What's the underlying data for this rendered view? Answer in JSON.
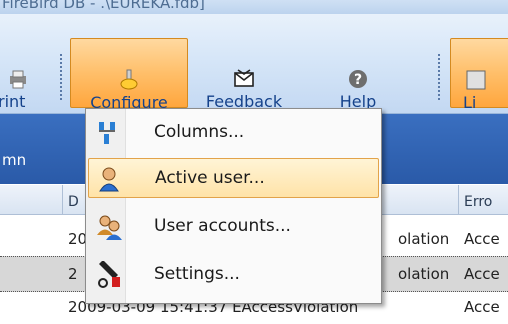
{
  "window": {
    "title": "FireBird DB - .\\EUREKA.fdb]"
  },
  "toolbar": {
    "print_label": "rint",
    "configure_label": "Configure",
    "feedback_label": "Feedback",
    "help_label": "Help",
    "li_label": "Li"
  },
  "grid": {
    "band_label": "mn",
    "headers": [
      "D",
      "Erro"
    ],
    "rows": [
      {
        "date": "20",
        "type": "olation",
        "err": "Acce",
        "selected": false
      },
      {
        "date": "2",
        "type": "olation",
        "err": "Acce",
        "selected": true
      },
      {
        "date": "2009-03-09 15:41:37 EAccessViolation",
        "type": "",
        "err": "Acce",
        "selected": false
      }
    ]
  },
  "menu": {
    "items": [
      {
        "label": "Columns...",
        "icon": "columns-icon"
      },
      {
        "label": "Active user...",
        "icon": "active-user-icon",
        "highlighted": true
      },
      {
        "label": "User accounts...",
        "icon": "user-accounts-icon"
      },
      {
        "label": "Settings...",
        "icon": "settings-icon"
      }
    ]
  },
  "colors": {
    "menu_highlight": "#ffe3a8",
    "active_button": "#ffbf6a",
    "header_band": "#2a5aa8"
  }
}
